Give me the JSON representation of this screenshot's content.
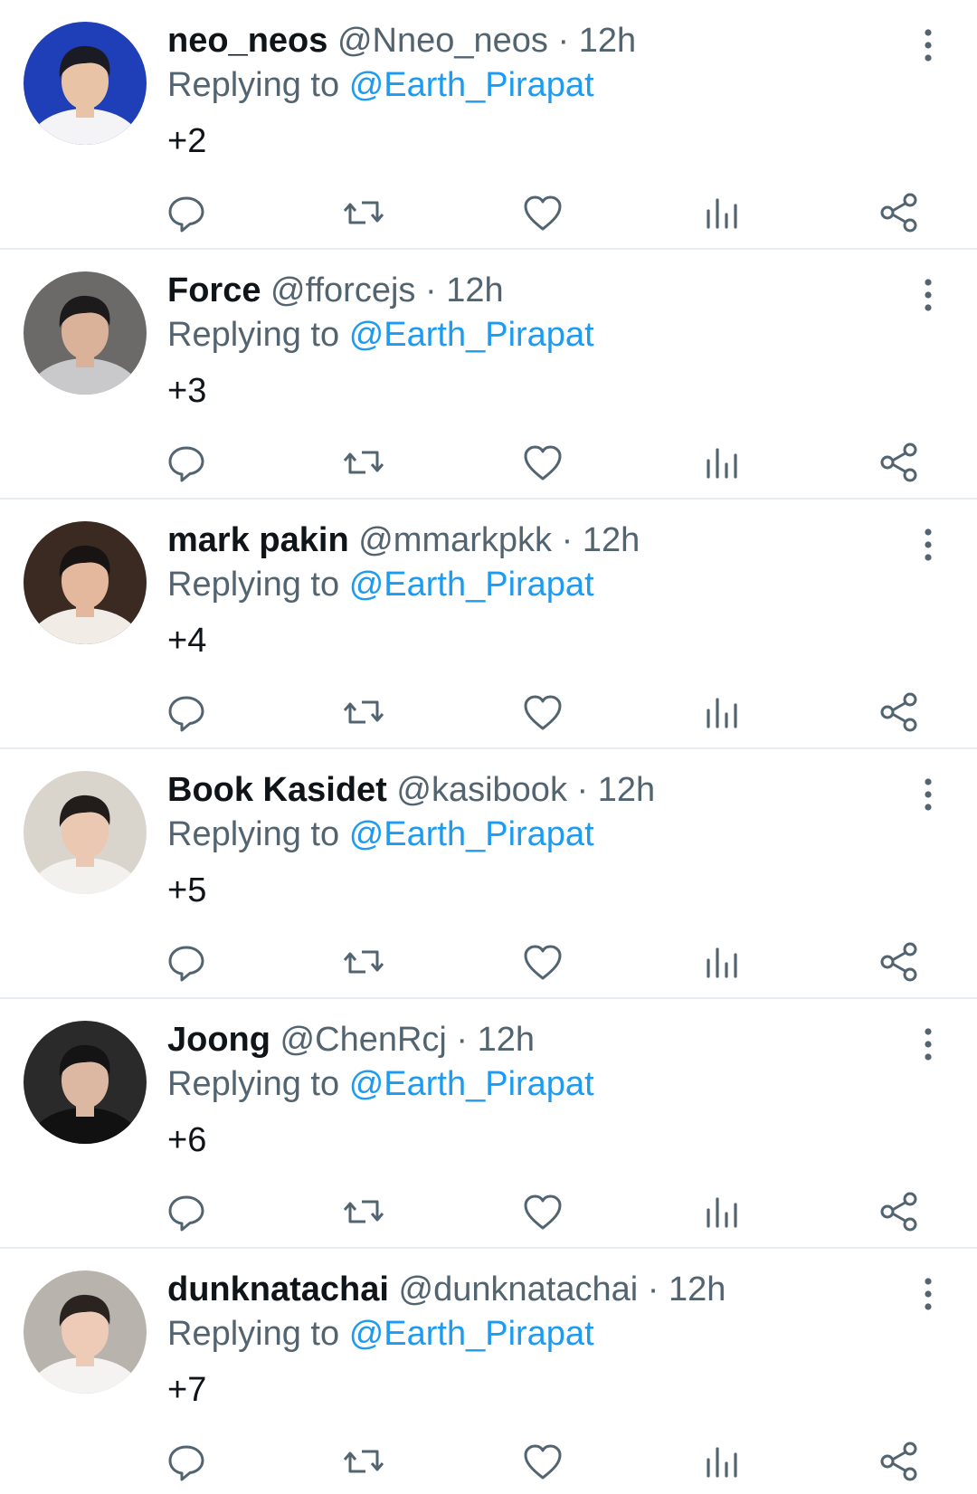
{
  "replies": [
    {
      "name": "neo_neos",
      "handle": "@Nneo_neos",
      "separator": "·",
      "time": "12h",
      "replying_prefix": "Replying to",
      "replying_to": "@Earth_Pirapat",
      "text": "+2",
      "avatar_colors": {
        "bg": "#1f3fb8",
        "skin": "#e9c3a6",
        "hair": "#1b1b24",
        "shirt": "#f4f4f6"
      }
    },
    {
      "name": "Force",
      "handle": "@fforcejs",
      "separator": "·",
      "time": "12h",
      "replying_prefix": "Replying to",
      "replying_to": "@Earth_Pirapat",
      "text": "+3",
      "avatar_colors": {
        "bg": "#6b6a68",
        "skin": "#d9b299",
        "hair": "#1c1a1a",
        "shirt": "#c9c9cc"
      }
    },
    {
      "name": "mark pakin",
      "handle": "@mmarkpkk",
      "separator": "·",
      "time": "12h",
      "replying_prefix": "Replying to",
      "replying_to": "@Earth_Pirapat",
      "text": "+4",
      "avatar_colors": {
        "bg": "#3a2a22",
        "skin": "#e3b89d",
        "hair": "#181413",
        "shirt": "#f1ede6"
      }
    },
    {
      "name": "Book Kasidet",
      "handle": "@kasibook",
      "separator": "·",
      "time": "12h",
      "replying_prefix": "Replying to",
      "replying_to": "@Earth_Pirapat",
      "text": "+5",
      "avatar_colors": {
        "bg": "#d9d4cc",
        "skin": "#eac8b2",
        "hair": "#221c1a",
        "shirt": "#f3f1ee"
      }
    },
    {
      "name": "Joong",
      "handle": "@ChenRcj",
      "separator": "·",
      "time": "12h",
      "replying_prefix": "Replying to",
      "replying_to": "@Earth_Pirapat",
      "text": "+6",
      "avatar_colors": {
        "bg": "#2a2a2a",
        "skin": "#dcb8a2",
        "hair": "#141414",
        "shirt": "#111111"
      }
    },
    {
      "name": "dunknatachai",
      "handle": "@dunknatachai",
      "separator": "·",
      "time": "12h",
      "replying_prefix": "Replying to",
      "replying_to": "@Earth_Pirapat",
      "text": "+7",
      "avatar_colors": {
        "bg": "#b9b3ad",
        "skin": "#edcbb6",
        "hair": "#2a2320",
        "shirt": "#f5f3f1"
      }
    }
  ],
  "icons": {
    "more": "more-vertical-icon",
    "reply": "reply-bubble-icon",
    "retweet": "retweet-icon",
    "like": "heart-icon",
    "views": "views-chart-icon",
    "share": "share-icon"
  },
  "colors": {
    "mention": "#1d9bf0",
    "secondary_text": "#536471",
    "icon": "#536471",
    "divider": "#e6ecf0"
  }
}
